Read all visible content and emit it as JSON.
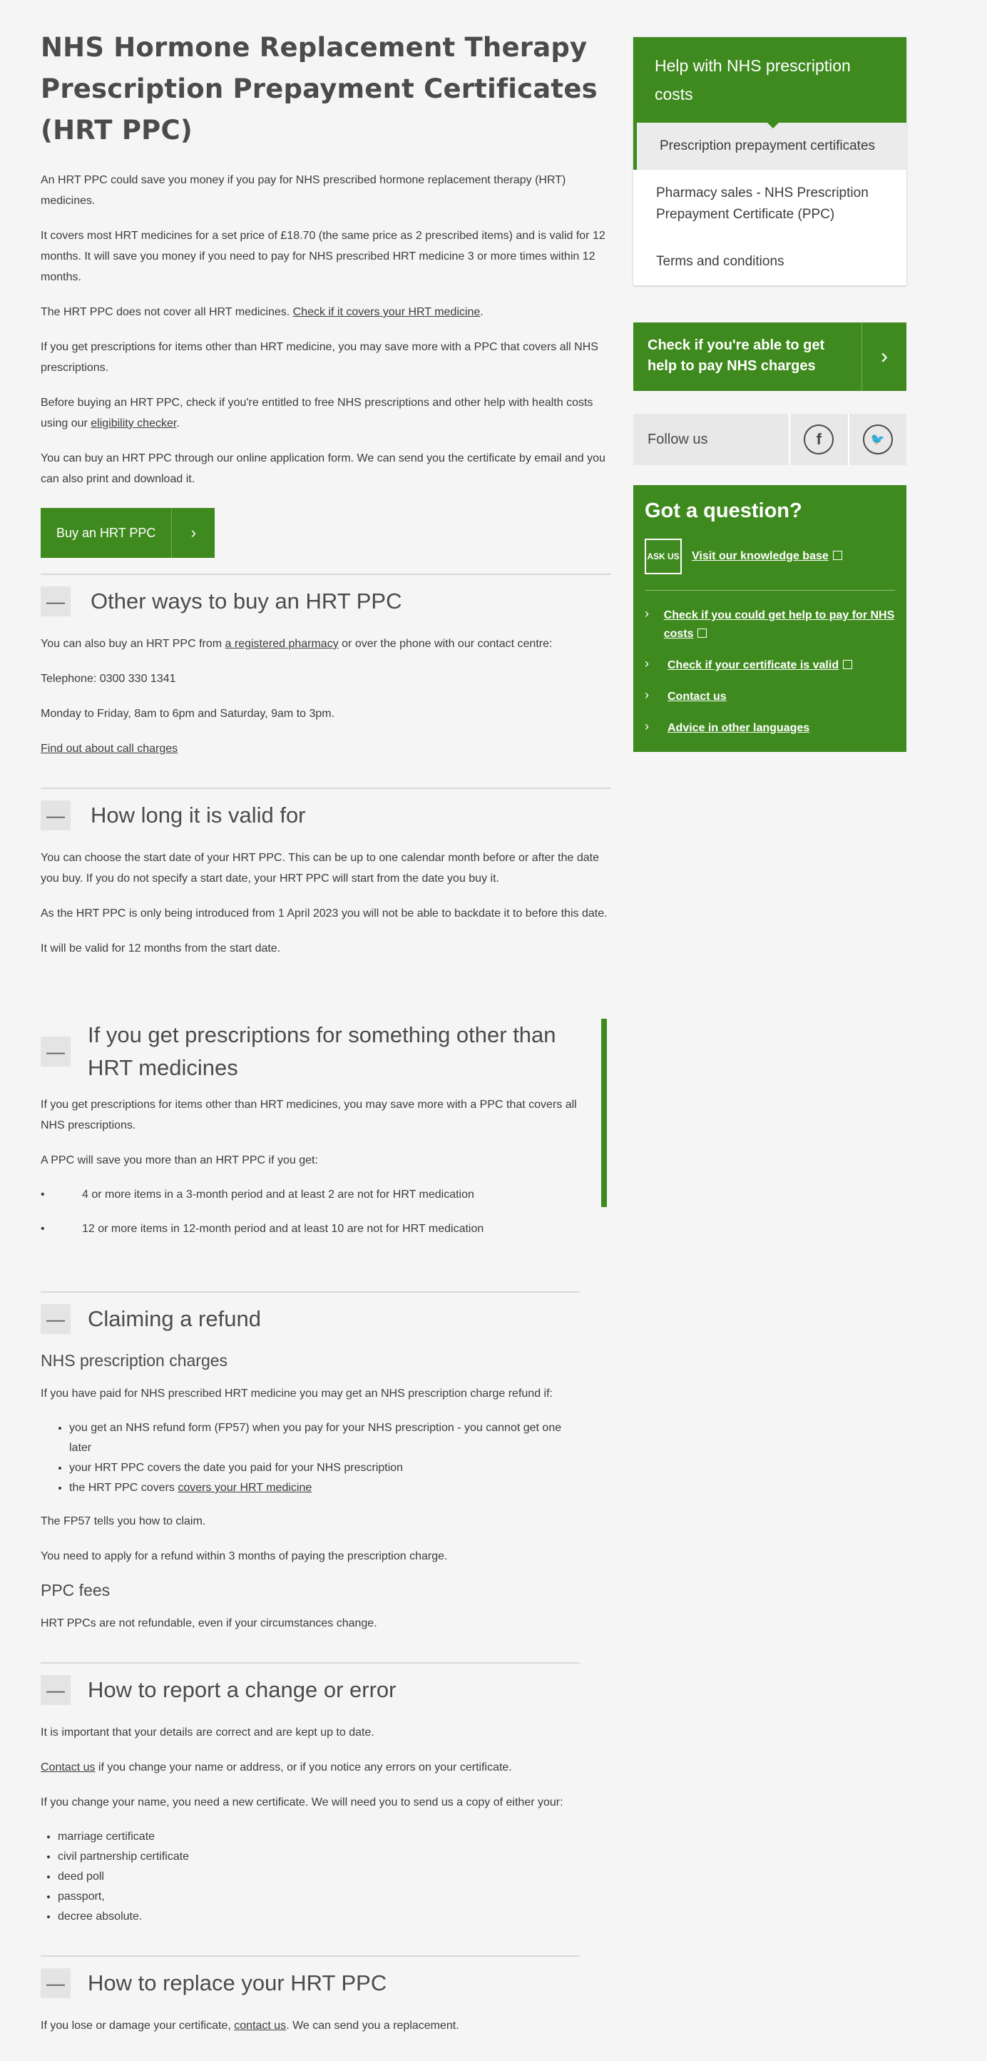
{
  "page": {
    "title": "NHS Hormone Replacement Therapy Prescription Prepayment Certificates (HRT PPC)",
    "intro": [
      "An HRT PPC could save you money if you pay for NHS prescribed hormone replacement therapy (HRT) medicines.",
      "It covers most HRT medicines for a set price of £18.70 (the same price as 2 prescribed items) and is valid for 12 months. It will save you money if you need to pay for NHS prescribed HRT medicine 3 or more times within 12 months."
    ],
    "cover_text": "The HRT PPC does not cover all HRT medicines. ",
    "cover_link": "Check if it covers your HRT medicine",
    "cover_end": ".",
    "other_items_text": "If you get prescriptions for items other than HRT medicine, you may save more with a PPC that covers all NHS prescriptions.",
    "before_text": "Before buying an HRT PPC, check if you're entitled to free NHS prescriptions and other help with health costs using our ",
    "before_link": "eligibility checker",
    "before_end": ".",
    "online_text": "You can buy an HRT PPC through our online application form. We can send you the certificate by email and you can also print and download it.",
    "buy_button": "Buy an HRT PPC",
    "buy_arrow": "›"
  },
  "sections": {
    "other_ways": {
      "toggle": "—",
      "title": "Other ways to buy an HRT PPC",
      "p1_text": "You can also buy an HRT PPC from ",
      "p1_link": "a registered pharmacy",
      "p1_end": "  or over the phone with our contact centre:",
      "telephone": "Telephone: 0300 330 1341",
      "hours": "Monday to Friday, 8am to 6pm and Saturday, 9am to 3pm.",
      "call_link": "Find out about call charges"
    },
    "valid": {
      "toggle": "—",
      "title": "How long it is valid for",
      "p1": "You can choose the start date of your HRT PPC. This can be up to one calendar month before or after the date you buy. If you do not specify a start date, your HRT PPC will start from the date you buy it.",
      "p2": "As the HRT PPC is only being introduced from 1 April 2023 you will not be able to backdate it to before this date.",
      "p3": "It will be valid for 12 months from the start date."
    },
    "other_medicines": {
      "toggle": "—",
      "title": "If you get prescriptions for something other than HRT medicines",
      "p1": "If you get prescriptions for items other than HRT medicines, you may save more with a PPC that covers all NHS prescriptions.",
      "p2": "A PPC will save you more than an HRT PPC if you get:",
      "bullet": "•",
      "items": [
        "4 or more items in a 3-month period and at least 2 are not for HRT medication",
        "12 or more items in 12-month period and at least 10 are not for HRT medication"
      ]
    },
    "refund": {
      "toggle": "—",
      "title": "Claiming a refund",
      "sub1": "NHS prescription charges",
      "p1": "If you have paid for NHS prescribed HRT medicine you may get an NHS prescription charge refund if:",
      "items": [
        "you get an NHS refund form (FP57) when you pay for your NHS prescription - you cannot get one later",
        "your HRT PPC covers the date you paid for your NHS prescription"
      ],
      "item3_text": "the HRT PPC covers ",
      "item3_link": "covers your HRT medicine",
      "p2": "The FP57 tells you how to claim.",
      "p3": "You need to apply for a refund within 3 months of paying the prescription charge.",
      "sub2": "PPC fees",
      "p4": "HRT PPCs are not refundable, even if your circumstances change."
    },
    "report": {
      "toggle": "—",
      "title": "How to report a change or error",
      "p1": "It is important that your details are correct and are kept up to date.",
      "p2_link": "Contact us",
      "p2_text": " if you change your name or address, or if you notice any errors on your certificate.",
      "p3": "If you change your name, you need a new certificate. We will need you to send us a copy of either your:",
      "items": [
        "marriage certificate",
        "civil partnership certificate",
        "deed poll",
        "passport,",
        "decree absolute."
      ]
    },
    "replace": {
      "toggle": "—",
      "title": "How to replace your HRT PPC",
      "p1_text": "If you lose or damage your certificate, ",
      "p1_link": "contact us",
      "p1_end": ". We can send you a replacement."
    }
  },
  "sidebar": {
    "help_title": "Help with NHS prescription costs",
    "nav": [
      "Prescription prepayment certificates",
      "Pharmacy sales - NHS Prescription Prepayment Certificate (PPC)",
      "Terms and conditions"
    ],
    "check_title": "Check if you're able to get help to pay NHS charges",
    "check_arrow": "›",
    "follow": "Follow us",
    "facebook": "f",
    "twitter": "🐦",
    "question_title": "Got a question?",
    "ask_badge": "ASK US",
    "knowledge_link": "Visit our knowledge base",
    "chevron": "›",
    "links": [
      "Check if you could get help to pay for NHS costs",
      "Check if your certificate is valid",
      "Contact us",
      "Advice in other languages"
    ]
  },
  "colors": {
    "nhs_green": "#3f8a1e",
    "text": "#3c3c3c",
    "background": "#f5f5f5"
  }
}
